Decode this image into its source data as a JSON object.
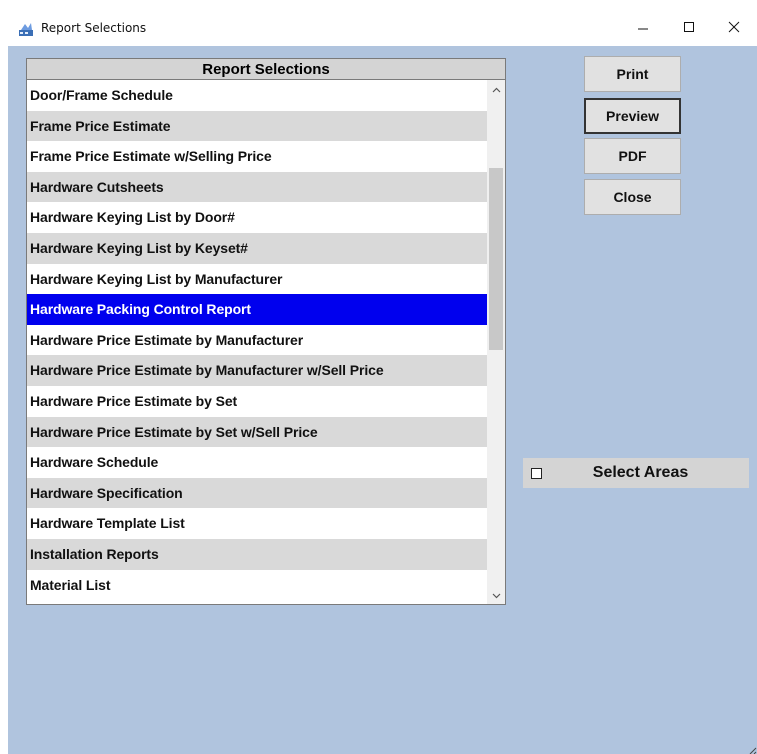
{
  "window": {
    "title": "Report Selections",
    "controls": {
      "minimize": "minimize",
      "maximize": "maximize",
      "close": "close"
    }
  },
  "list": {
    "header": "Report Selections",
    "selected_index": 7,
    "items": [
      "Door/Frame Schedule",
      "Frame Price Estimate",
      "Frame Price Estimate w/Selling Price",
      "Hardware Cutsheets",
      "Hardware Keying List by Door#",
      "Hardware Keying List by Keyset#",
      "Hardware Keying List by Manufacturer",
      "Hardware Packing Control Report",
      "Hardware Price Estimate by Manufacturer",
      "Hardware Price Estimate by Manufacturer w/Sell Price",
      "Hardware Price Estimate by Set",
      "Hardware Price Estimate by Set w/Sell Price",
      "Hardware Schedule",
      "Hardware Specification",
      "Hardware Template List",
      "Installation Reports",
      "Material List"
    ]
  },
  "buttons": {
    "print": "Print",
    "preview": "Preview",
    "pdf": "PDF",
    "close": "Close"
  },
  "select_areas": {
    "label": "Select Areas",
    "checked": false
  },
  "colors": {
    "client_bg": "#b0c4de",
    "selection": "#0000ee",
    "alt_row": "#d9d9d9"
  },
  "icons": {
    "app": "report-app-icon",
    "scroll_up": "chevron-up-icon",
    "scroll_down": "chevron-down-icon"
  }
}
